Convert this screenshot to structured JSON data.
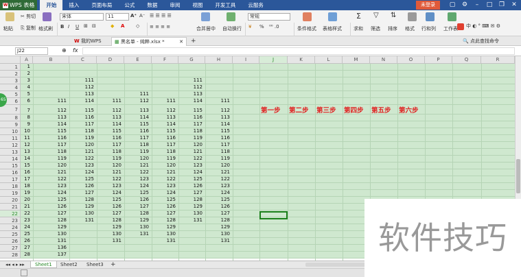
{
  "app": {
    "name": "WPS 表格",
    "login": "未登录"
  },
  "menu": [
    "开始",
    "插入",
    "页面布局",
    "公式",
    "数据",
    "审阅",
    "视图",
    "开发工具",
    "云服务"
  ],
  "ribbon": {
    "paste": "粘贴",
    "cut": "剪切",
    "copy": "复制",
    "format_painter": "格式刷",
    "font_name": "宋体",
    "font_size": "11",
    "number_format": "常规",
    "merge": "合并居中",
    "wrap": "自动换行",
    "cond_format": "条件格式",
    "table_style": "表格样式",
    "sum": "求和",
    "filter": "筛选",
    "sort": "排序",
    "format": "格式",
    "rowcol": "行和列",
    "worksheet": "工作表",
    "bold": "B",
    "italic": "I",
    "underline": "U",
    "percent": "%",
    "fontcolor": "A"
  },
  "file_tabs": {
    "home": "我的WPS",
    "doc": "黑名单 - 纯粹.xlsx *",
    "search": "点此查找命令"
  },
  "formula": {
    "cell_ref": "J22",
    "fx": "fx"
  },
  "columns": [
    "A",
    "B",
    "C",
    "D",
    "E",
    "F",
    "G",
    "H",
    "I",
    "J",
    "K",
    "L",
    "M",
    "N",
    "O",
    "P",
    "Q",
    "R"
  ],
  "rows": [
    {
      "n": "1",
      "a": "1",
      "b": "",
      "c": "",
      "d": "",
      "e": "",
      "f": "",
      "g": "",
      "h": ""
    },
    {
      "n": "2",
      "a": "2",
      "b": "",
      "c": "",
      "d": "",
      "e": "",
      "f": "",
      "g": "",
      "h": ""
    },
    {
      "n": "3",
      "a": "3",
      "b": "",
      "c": "111",
      "d": "",
      "e": "",
      "f": "",
      "g": "111",
      "h": ""
    },
    {
      "n": "4",
      "a": "4",
      "b": "",
      "c": "112",
      "d": "",
      "e": "",
      "f": "",
      "g": "112",
      "h": ""
    },
    {
      "n": "5",
      "a": "5",
      "b": "",
      "c": "113",
      "d": "",
      "e": "111",
      "f": "",
      "g": "113",
      "h": ""
    },
    {
      "n": "6",
      "a": "6",
      "b": "111",
      "c": "114",
      "d": "111",
      "e": "112",
      "f": "111",
      "g": "114",
      "h": "111"
    },
    {
      "n": "7",
      "a": "7",
      "b": "112",
      "c": "115",
      "d": "112",
      "e": "113",
      "f": "112",
      "g": "115",
      "h": "112"
    },
    {
      "n": "8",
      "a": "8",
      "b": "113",
      "c": "116",
      "d": "113",
      "e": "114",
      "f": "113",
      "g": "116",
      "h": "113"
    },
    {
      "n": "9",
      "a": "9",
      "b": "114",
      "c": "117",
      "d": "114",
      "e": "115",
      "f": "114",
      "g": "117",
      "h": "114"
    },
    {
      "n": "10",
      "a": "10",
      "b": "115",
      "c": "118",
      "d": "115",
      "e": "116",
      "f": "115",
      "g": "118",
      "h": "115"
    },
    {
      "n": "11",
      "a": "11",
      "b": "116",
      "c": "119",
      "d": "116",
      "e": "117",
      "f": "116",
      "g": "119",
      "h": "116"
    },
    {
      "n": "12",
      "a": "12",
      "b": "117",
      "c": "120",
      "d": "117",
      "e": "118",
      "f": "117",
      "g": "120",
      "h": "117"
    },
    {
      "n": "13",
      "a": "13",
      "b": "118",
      "c": "121",
      "d": "118",
      "e": "119",
      "f": "118",
      "g": "121",
      "h": "118"
    },
    {
      "n": "14",
      "a": "14",
      "b": "119",
      "c": "122",
      "d": "119",
      "e": "120",
      "f": "119",
      "g": "122",
      "h": "119"
    },
    {
      "n": "15",
      "a": "15",
      "b": "120",
      "c": "123",
      "d": "120",
      "e": "121",
      "f": "120",
      "g": "123",
      "h": "120"
    },
    {
      "n": "16",
      "a": "16",
      "b": "121",
      "c": "124",
      "d": "121",
      "e": "122",
      "f": "121",
      "g": "124",
      "h": "121"
    },
    {
      "n": "17",
      "a": "17",
      "b": "122",
      "c": "125",
      "d": "122",
      "e": "123",
      "f": "122",
      "g": "125",
      "h": "122"
    },
    {
      "n": "18",
      "a": "18",
      "b": "123",
      "c": "126",
      "d": "123",
      "e": "124",
      "f": "123",
      "g": "126",
      "h": "123"
    },
    {
      "n": "19",
      "a": "19",
      "b": "124",
      "c": "127",
      "d": "124",
      "e": "125",
      "f": "124",
      "g": "127",
      "h": "124"
    },
    {
      "n": "20",
      "a": "20",
      "b": "125",
      "c": "128",
      "d": "125",
      "e": "126",
      "f": "125",
      "g": "128",
      "h": "125"
    },
    {
      "n": "21",
      "a": "21",
      "b": "126",
      "c": "129",
      "d": "126",
      "e": "127",
      "f": "126",
      "g": "129",
      "h": "126"
    },
    {
      "n": "22",
      "a": "22",
      "b": "127",
      "c": "130",
      "d": "127",
      "e": "128",
      "f": "127",
      "g": "130",
      "h": "127"
    },
    {
      "n": "23",
      "a": "23",
      "b": "128",
      "c": "131",
      "d": "128",
      "e": "129",
      "f": "128",
      "g": "131",
      "h": "128"
    },
    {
      "n": "24",
      "a": "24",
      "b": "129",
      "c": "",
      "d": "129",
      "e": "130",
      "f": "129",
      "g": "",
      "h": "129"
    },
    {
      "n": "25",
      "a": "25",
      "b": "130",
      "c": "",
      "d": "130",
      "e": "131",
      "f": "130",
      "g": "",
      "h": "130"
    },
    {
      "n": "26",
      "a": "26",
      "b": "131",
      "c": "",
      "d": "131",
      "e": "",
      "f": "131",
      "g": "",
      "h": "131"
    },
    {
      "n": "27",
      "a": "27",
      "b": "136",
      "c": "",
      "d": "",
      "e": "",
      "f": "",
      "g": "",
      "h": ""
    },
    {
      "n": "28",
      "a": "28",
      "b": "137",
      "c": "",
      "d": "",
      "e": "",
      "f": "",
      "g": "",
      "h": ""
    }
  ],
  "steps": [
    "第一步",
    "第二步",
    "第三步",
    "第四步",
    "第五步",
    "第六步"
  ],
  "sheets": [
    "Sheet1",
    "Sheet2",
    "Sheet3"
  ],
  "watermark": "软件技巧",
  "colors": {
    "cell_bg": "#cfe8cf",
    "step": "#e02020",
    "title": "#2b579a"
  }
}
